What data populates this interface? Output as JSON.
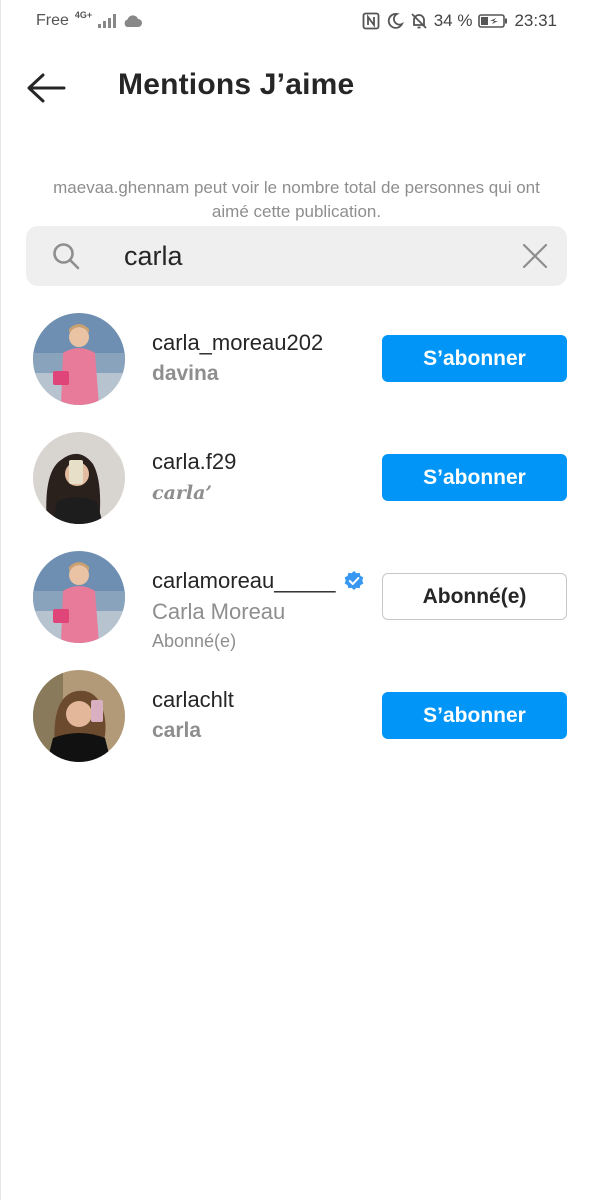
{
  "status_bar": {
    "carrier": "Free",
    "network": "4G+",
    "battery": "34 %",
    "time": "23:31"
  },
  "header": {
    "title": "Mentions J’aime"
  },
  "info": {
    "text": "maevaa.ghennam peut voir le nombre total de personnes qui ont aimé cette publication."
  },
  "search": {
    "value": "carla"
  },
  "users": [
    {
      "username": "carla_moreau202",
      "fullname": "davina",
      "subtext": "",
      "verified": false,
      "button": "S’abonner"
    },
    {
      "username": "carla.f29",
      "fullname": "carla’",
      "subtext": "",
      "verified": false,
      "button": "S’abonner"
    },
    {
      "username": "carlamoreau_____",
      "fullname": "Carla Moreau",
      "subtext": "Abonné(e)",
      "verified": true,
      "button": "Abonné(e)"
    },
    {
      "username": "carlachlt",
      "fullname": "carla",
      "subtext": "",
      "verified": false,
      "button": "S’abonner"
    }
  ],
  "colors": {
    "accent": "#0095f6",
    "secondary_text": "#8e8e8e",
    "search_bg": "#efefef"
  }
}
